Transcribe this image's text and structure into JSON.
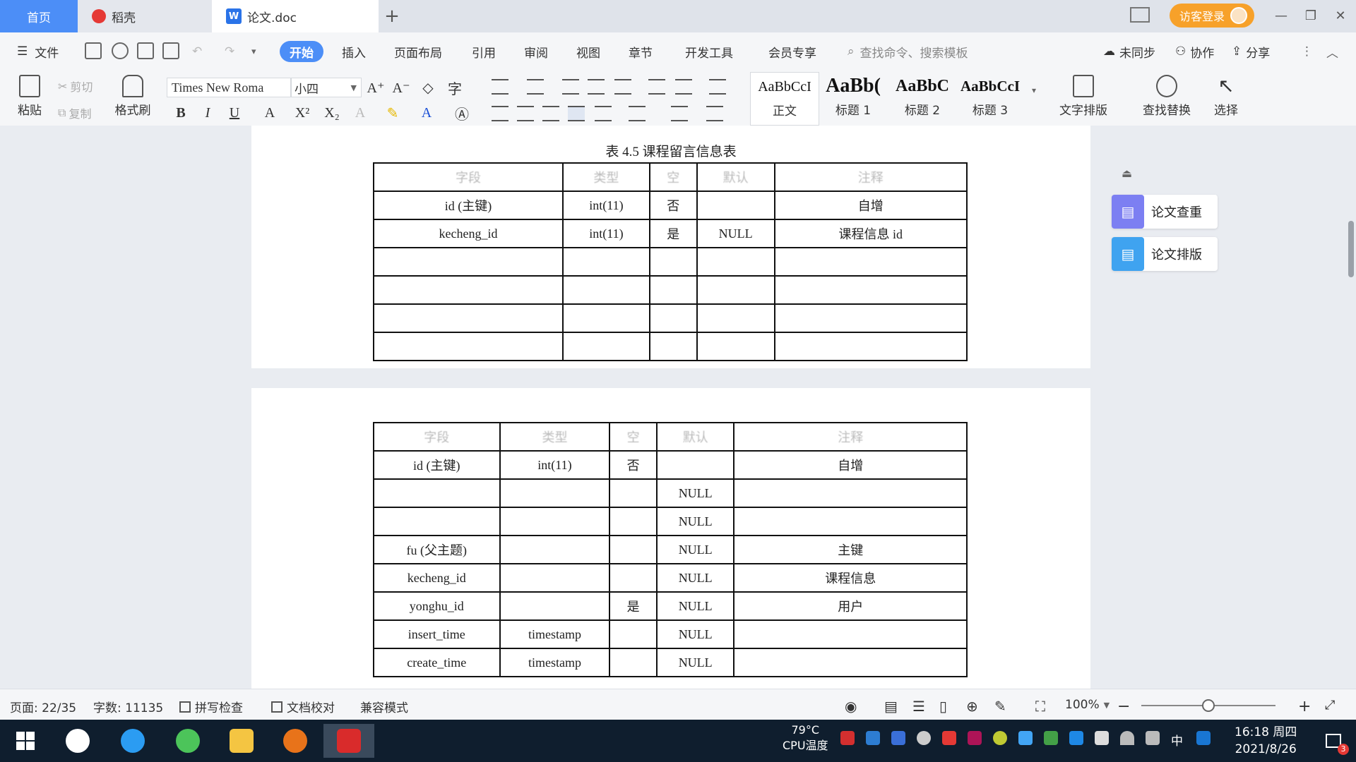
{
  "titlebar": {
    "tab_home": "首页",
    "tab_daoke": "稻壳",
    "tab_doc": "论文.doc",
    "tab_add": "+",
    "login": "访客登录"
  },
  "menu": {
    "file": "文件",
    "items": [
      "开始",
      "插入",
      "页面布局",
      "引用",
      "审阅",
      "视图",
      "章节",
      "开发工具",
      "会员专享"
    ],
    "search_placeholder": "查找命令、搜索模板",
    "sync": "未同步",
    "collab": "协作",
    "share": "分享"
  },
  "ribbon": {
    "paste": "粘贴",
    "cut": "剪切",
    "copy": "复制",
    "format_painter": "格式刷",
    "font_name": "Times New Roma",
    "font_size": "小四",
    "styles": [
      {
        "sample": "AaBbCcI",
        "label": "正文"
      },
      {
        "sample": "AaBb(",
        "label": "标题 1"
      },
      {
        "sample": "AaBbC",
        "label": "标题 2"
      },
      {
        "sample": "AaBbCcI",
        "label": "标题 3"
      }
    ],
    "text_layout": "文字排版",
    "find_replace": "查找替换",
    "select": "选择"
  },
  "document": {
    "caption": "表 4.5  课程留言信息表",
    "table1": {
      "rows": [
        [
          "字段",
          "类型",
          "空",
          "默认",
          "注释"
        ],
        [
          "id (主键)",
          "int(11)",
          "否",
          "",
          "自增"
        ],
        [
          "kecheng_id",
          "int(11)",
          "是",
          "NULL",
          "课程信息 id"
        ],
        [
          "",
          "",
          "",
          "",
          ""
        ],
        [
          "",
          "",
          "",
          "",
          ""
        ],
        [
          "",
          "",
          "",
          "",
          ""
        ],
        [
          "",
          "",
          "",
          "",
          ""
        ]
      ]
    },
    "table2": {
      "rows": [
        [
          "字段",
          "类型",
          "空",
          "默认",
          "注释"
        ],
        [
          "id (主键)",
          "int(11)",
          "否",
          "",
          "自增"
        ],
        [
          "",
          "",
          "",
          "NULL",
          ""
        ],
        [
          "",
          "",
          "",
          "NULL",
          ""
        ],
        [
          "fu (父主题)",
          "",
          "",
          "NULL",
          "主键"
        ],
        [
          "kecheng_id",
          "",
          "",
          "NULL",
          "课程信息"
        ],
        [
          "yonghu_id",
          "",
          "是",
          "NULL",
          "用户"
        ],
        [
          "insert_time",
          "timestamp",
          "",
          "NULL",
          ""
        ],
        [
          "create_time",
          "timestamp",
          "",
          "NULL",
          ""
        ]
      ]
    }
  },
  "sidebar": {
    "check": "论文查重",
    "layout": "论文排版"
  },
  "statusbar": {
    "page": "页面: 22/35",
    "words": "字数: 11135",
    "spellcheck": "拼写检查",
    "doc_check": "文档校对",
    "compat": "兼容模式",
    "zoom": "100%",
    "zoom_level": 0.5
  },
  "taskbar": {
    "cpu_temp": "79°C",
    "cpu_label": "CPU温度",
    "ime": "中",
    "time": "16:18 周四",
    "date": "2021/8/26",
    "notif_count": "3"
  }
}
